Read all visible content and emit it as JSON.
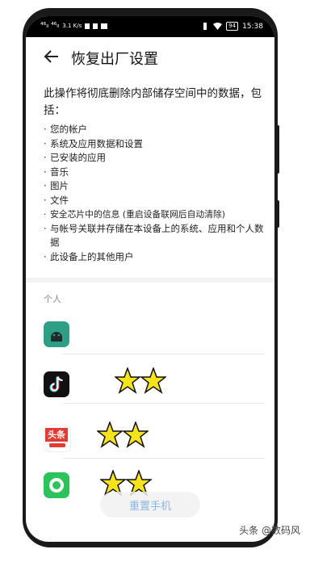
{
  "status_bar": {
    "carrier": "⁴⁶ₗₗ ⁴⁶ₗₗ",
    "speed": "3.1 K/s",
    "battery": "94",
    "time": "15:38"
  },
  "header": {
    "title": "恢复出厂设置"
  },
  "description": "此操作将彻底删除内部储存空间中的数据，包括：",
  "items": [
    "您的帐户",
    "系统及应用数据和设置",
    "已安装的应用",
    "音乐",
    "图片",
    "文件",
    "安全芯片中的信息 (重启设备联网后自动清除)",
    "与帐号关联并存储在本设备上的系统、应用和个人数据",
    "此设备上的其他用户"
  ],
  "section_label": "个人",
  "apps": [
    {
      "icon": "android-icon"
    },
    {
      "icon": "tiktok-icon"
    },
    {
      "icon": "toutiao-icon",
      "icon_text": "头条"
    },
    {
      "icon": "green-chat-icon"
    }
  ],
  "reset_button": "重置手机",
  "watermark": "头条 @数码风",
  "colors": {
    "accent": "#3c7fd9",
    "censor": "#f7e31c"
  }
}
